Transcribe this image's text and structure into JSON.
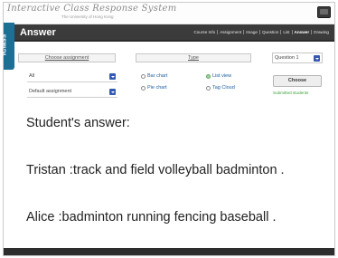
{
  "brand": {
    "logo_text": "Interactive Class Response System",
    "subtitle": "The University of Hong Kong"
  },
  "side_tab": {
    "label": "iClass"
  },
  "header": {
    "title": "Answer",
    "nav": [
      {
        "label": "Course Info"
      },
      {
        "label": "Assignment"
      },
      {
        "label": "Image"
      },
      {
        "label": "Question"
      },
      {
        "label": "List"
      },
      {
        "label": "Answer"
      },
      {
        "label": "Drawing"
      }
    ]
  },
  "controls": {
    "assignment_heading": "Choose assignment",
    "type_heading": "Type",
    "course_select": {
      "value": "All"
    },
    "assignment_select": {
      "value": "Default assignment"
    },
    "question_select": {
      "value": "Question 1"
    },
    "types": {
      "bar_chart": "Bar chart",
      "pie_chart": "Pie chart",
      "list_view": "List view",
      "tag_cloud": "Tag Cloud"
    },
    "selected_type": "List view",
    "choose_label": "Choose",
    "status": "Submitted students"
  },
  "answers": {
    "heading": "Student's answer:",
    "items": [
      {
        "student": "Tristan",
        "text": "track and field volleyball badminton ."
      },
      {
        "student": "Alice",
        "text": "badminton running fencing baseball ."
      }
    ]
  },
  "colors": {
    "nav_bg": "#3b3b3b",
    "side_tab": "#1d6f95",
    "select_arrow": "#3559b3",
    "status_text": "#3aa33a"
  },
  "icons": {
    "device": "handheld-device-icon",
    "dropdown": "chevron-down-icon",
    "radio": "radio-button-icon"
  }
}
